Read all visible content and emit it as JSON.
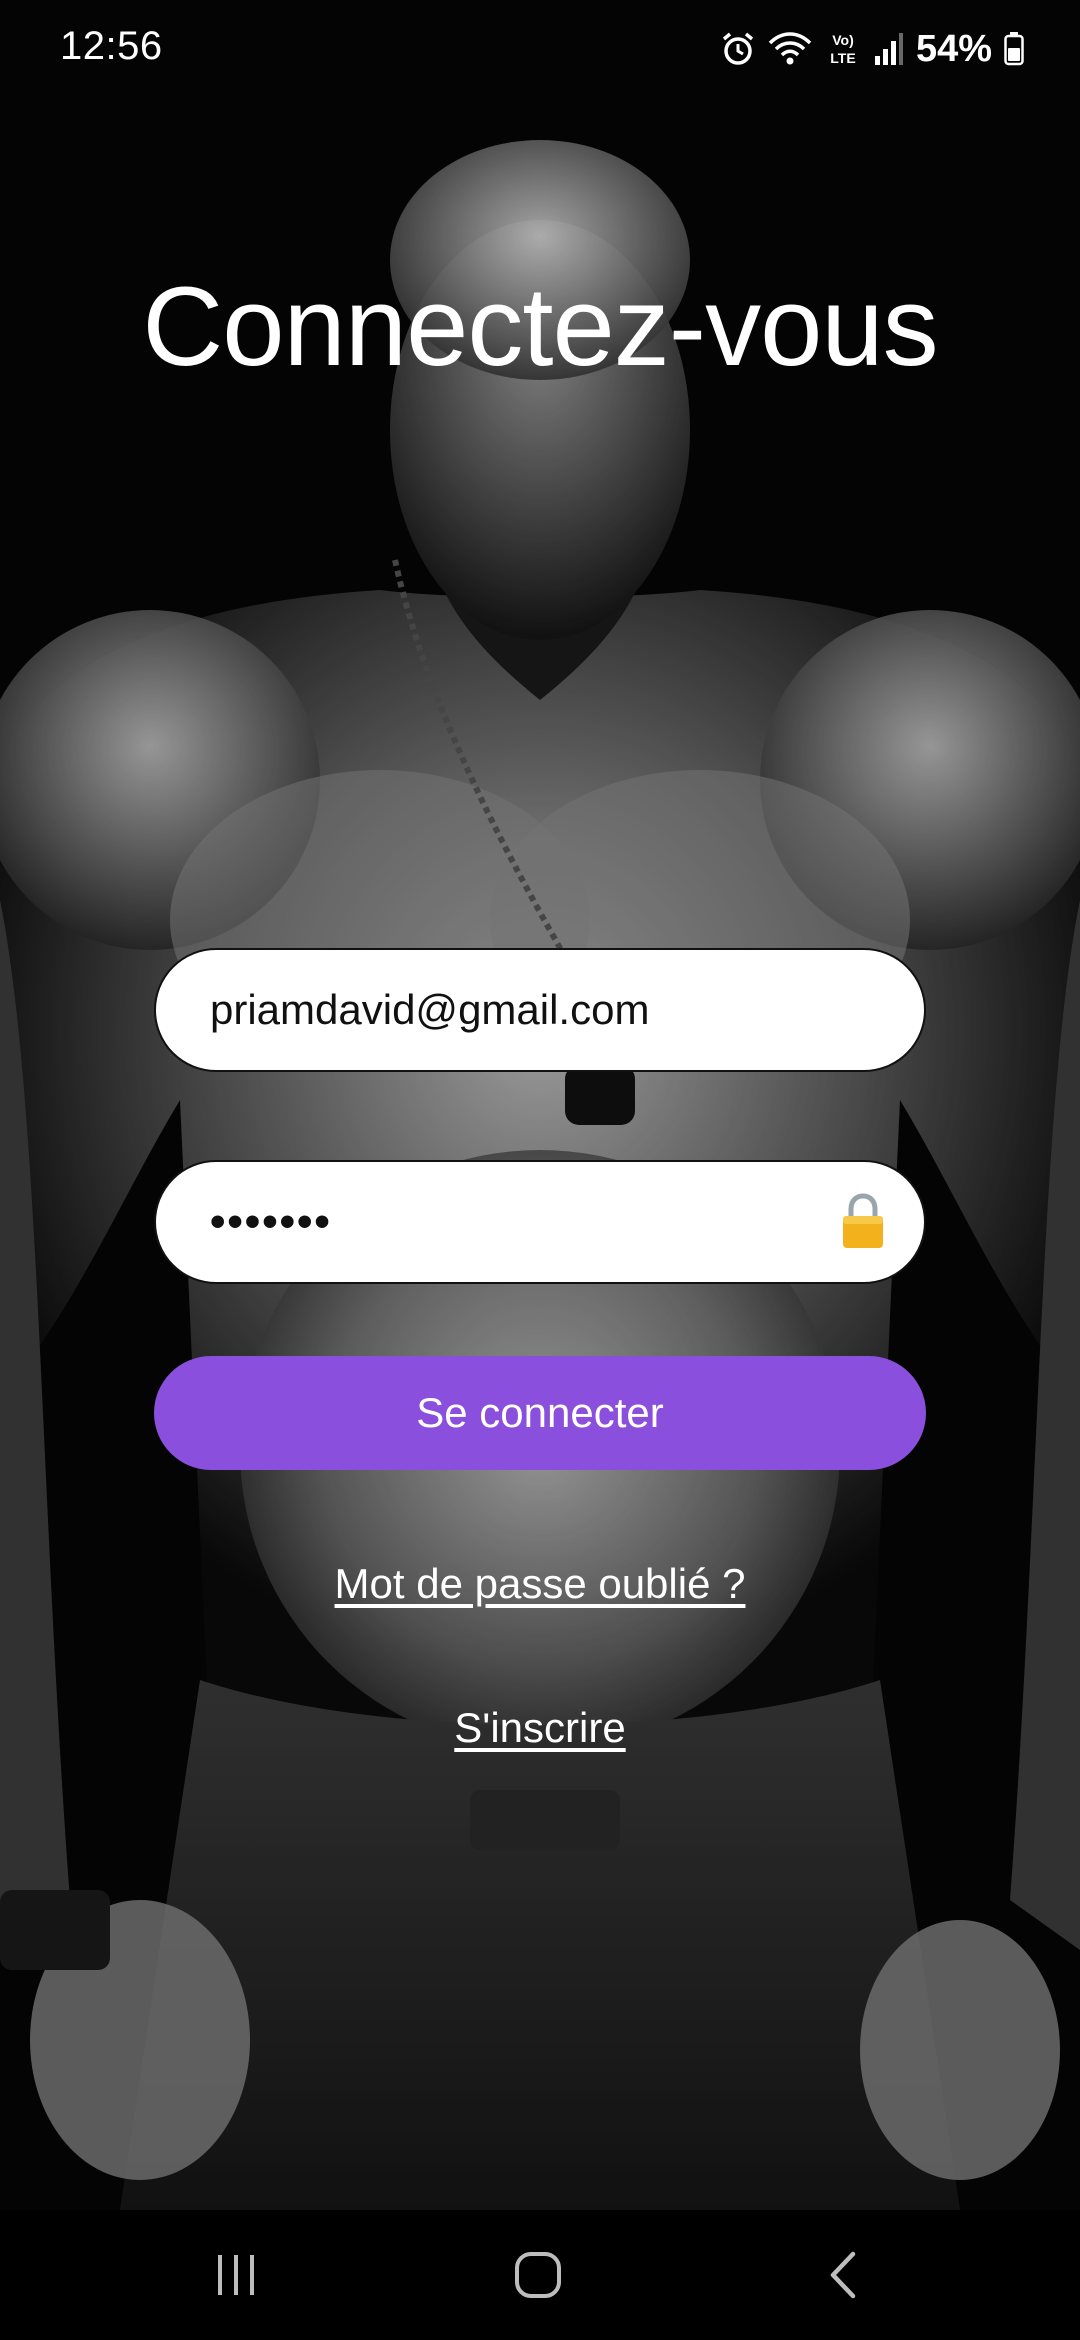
{
  "status_bar": {
    "time": "12:56",
    "battery": "54%",
    "icons": [
      "alarm-icon",
      "wifi-icon",
      "volte-lte-icon",
      "signal-icon",
      "battery-icon"
    ],
    "volte_label": "Vo)",
    "lte_label": "LTE"
  },
  "login": {
    "title": "Connectez-vous",
    "email_value": "priamdavid@gmail.com",
    "password_value": "•••••••",
    "lock_icon": "lock-icon",
    "submit_label": "Se connecter",
    "forgot_label": "Mot de passe oublié ?",
    "signup_label": "S'inscrire"
  },
  "theme": {
    "accent": "#8a4fdc",
    "field_bg": "#ffffff",
    "text_light": "#ffffff"
  },
  "nav_bar": {
    "icons": [
      "recents-icon",
      "home-icon",
      "back-icon"
    ]
  }
}
